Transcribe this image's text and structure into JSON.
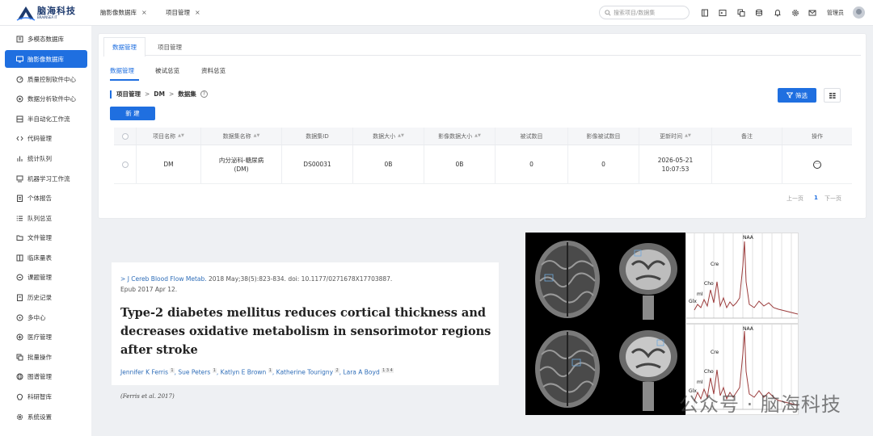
{
  "app": {
    "logo_cn": "脑海科技",
    "logo_en": "BRAINSEA IT",
    "open_tabs": [
      {
        "label": "脑影像数据库",
        "close": "×"
      },
      {
        "label": "项目管理",
        "close": "×"
      }
    ],
    "search_placeholder": "搜索项目/数据集",
    "user_name": "管理员",
    "toolbar_icons": [
      "book-icon",
      "terminal-icon",
      "copy-icon",
      "database-icon",
      "bell-icon",
      "settings-icon",
      "mail-icon"
    ]
  },
  "sidebar": {
    "items": [
      {
        "label": "多模态数据库",
        "icon": "building-icon"
      },
      {
        "label": "脑影像数据库",
        "icon": "monitor-icon",
        "active": true
      },
      {
        "label": "质量控制软件中心",
        "icon": "gauge-icon"
      },
      {
        "label": "数据分析软件中心",
        "icon": "analysis-icon"
      },
      {
        "label": "半自动化工作流",
        "icon": "workflow-icon"
      },
      {
        "label": "代码管理",
        "icon": "code-icon"
      },
      {
        "label": "统计队列",
        "icon": "chart-icon"
      },
      {
        "label": "机器学习工作流",
        "icon": "ml-icon"
      },
      {
        "label": "个体报告",
        "icon": "report-icon"
      },
      {
        "label": "队列总览",
        "icon": "list-icon"
      },
      {
        "label": "文件管理",
        "icon": "folder-icon"
      },
      {
        "label": "临床量表",
        "icon": "scale-icon"
      },
      {
        "label": "课题管理",
        "icon": "topic-icon"
      },
      {
        "label": "历史记录",
        "icon": "history-icon"
      },
      {
        "label": "多中心",
        "icon": "center-icon"
      },
      {
        "label": "医疗管理",
        "icon": "medical-icon"
      },
      {
        "label": "批量操作",
        "icon": "batch-icon"
      },
      {
        "label": "图谱管理",
        "icon": "atlas-icon"
      },
      {
        "label": "科研智库",
        "icon": "brain-icon"
      },
      {
        "label": "系统设置",
        "icon": "gear-icon"
      }
    ]
  },
  "main": {
    "tabs": [
      {
        "label": "数据管理",
        "active": true
      },
      {
        "label": "项目管理",
        "active": false
      }
    ],
    "sub_tabs": [
      {
        "label": "数据管理",
        "active": true
      },
      {
        "label": "被试总览",
        "active": false
      },
      {
        "label": "资料总览",
        "active": false
      }
    ],
    "breadcrumb": [
      "项目管理",
      "DM",
      "数据集"
    ],
    "breadcrumb_sep": ">",
    "help": "?",
    "filter_label": "筛选",
    "new_label": "新 建",
    "table": {
      "columns": [
        "项目名称",
        "数据集名称",
        "数据集ID",
        "数据大小",
        "影像数据大小",
        "被试数目",
        "影像被试数目",
        "更新时间",
        "备注",
        "操作"
      ],
      "sortable": [
        true,
        true,
        false,
        true,
        true,
        false,
        false,
        true,
        false,
        false
      ],
      "rows": [
        {
          "project": "DM",
          "dataset_name_line1": "内分泌科-糖尿病",
          "dataset_name_line2": "(DM)",
          "dataset_id": "DS00031",
          "data_size": "0B",
          "image_size": "0B",
          "subjects": "0",
          "image_subjects": "0",
          "updated_date": "2026-05-21",
          "updated_time": "10:07:53",
          "note": "",
          "ops": "···"
        }
      ]
    },
    "pagination": {
      "prev": "上一页",
      "current": "1",
      "next": "下一页"
    }
  },
  "paper": {
    "journal_prefix": ">",
    "journal": "J Cereb Blood Flow Metab.",
    "citation": " 2018 May;38(5):823-834. doi: 10.1177/0271678X17703887.",
    "epub": "Epub 2017 Apr 12.",
    "title": "Type-2 diabetes mellitus reduces cortical thickness and decreases oxidative metabolism in sensorimotor regions after stroke",
    "authors": [
      {
        "name": "Jennifer K Ferris",
        "sup": "1"
      },
      {
        "name": "Sue Peters",
        "sup": "1"
      },
      {
        "name": "Katlyn E Brown",
        "sup": "1"
      },
      {
        "name": "Katherine Tourigny",
        "sup": "2"
      },
      {
        "name": "Lara A Boyd",
        "sup": "1 3 4"
      }
    ],
    "caption": "(Ferris et al.   2017)"
  },
  "figure": {
    "spectrum_labels": [
      "NAA",
      "Cre",
      "Cho",
      "mI",
      "Glx"
    ]
  },
  "watermark": "公众号 · 脑海科技"
}
